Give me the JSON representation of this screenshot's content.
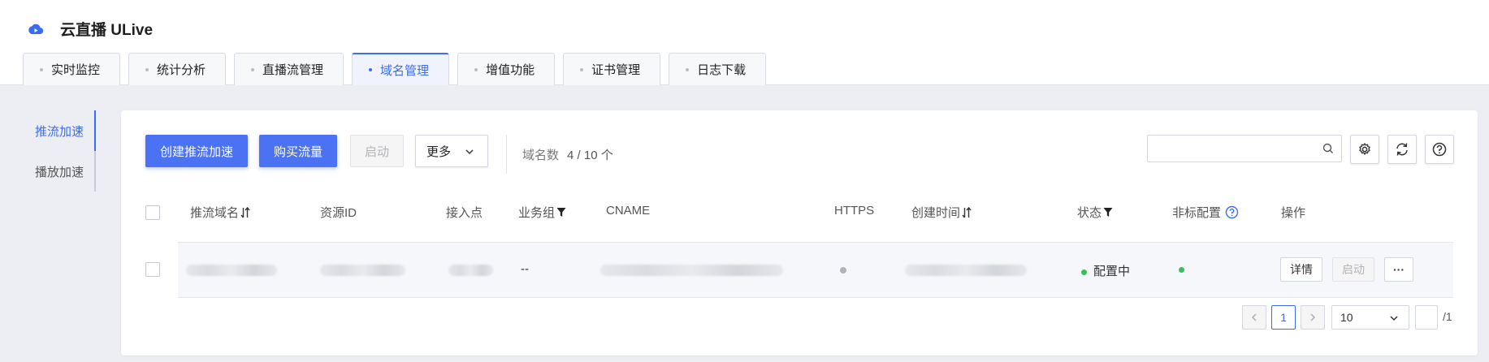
{
  "app": {
    "title": "云直播 ULive"
  },
  "tabs": [
    {
      "label": "实时监控"
    },
    {
      "label": "统计分析"
    },
    {
      "label": "直播流管理"
    },
    {
      "label": "域名管理",
      "active": true
    },
    {
      "label": "增值功能"
    },
    {
      "label": "证书管理"
    },
    {
      "label": "日志下载"
    }
  ],
  "sidebar": {
    "items": [
      {
        "label": "推流加速",
        "active": true
      },
      {
        "label": "播放加速"
      }
    ]
  },
  "toolbar": {
    "create_label": "创建推流加速",
    "buy_label": "购买流量",
    "start_label": "启动",
    "more_label": "更多",
    "count_label": "域名数",
    "count_value": "4 / 10 个",
    "search_placeholder": ""
  },
  "table": {
    "columns": [
      "推流域名",
      "资源ID",
      "接入点",
      "业务组",
      "CNAME",
      "HTTPS",
      "创建时间",
      "状态",
      "非标配置",
      "操作"
    ],
    "rows": [
      {
        "business_group": "--",
        "status": "配置中",
        "detail_label": "详情",
        "start_label": "启动",
        "more_label": "···"
      }
    ]
  },
  "pagination": {
    "current_page": "1",
    "page_size": "10",
    "total_pages": "/1",
    "prev_icon": "chevron-left-icon",
    "next_icon": "chevron-right-icon"
  },
  "colors": {
    "accent": "#4a72f2",
    "active_tab": "#3c6df0",
    "status_green": "#36c25b"
  }
}
